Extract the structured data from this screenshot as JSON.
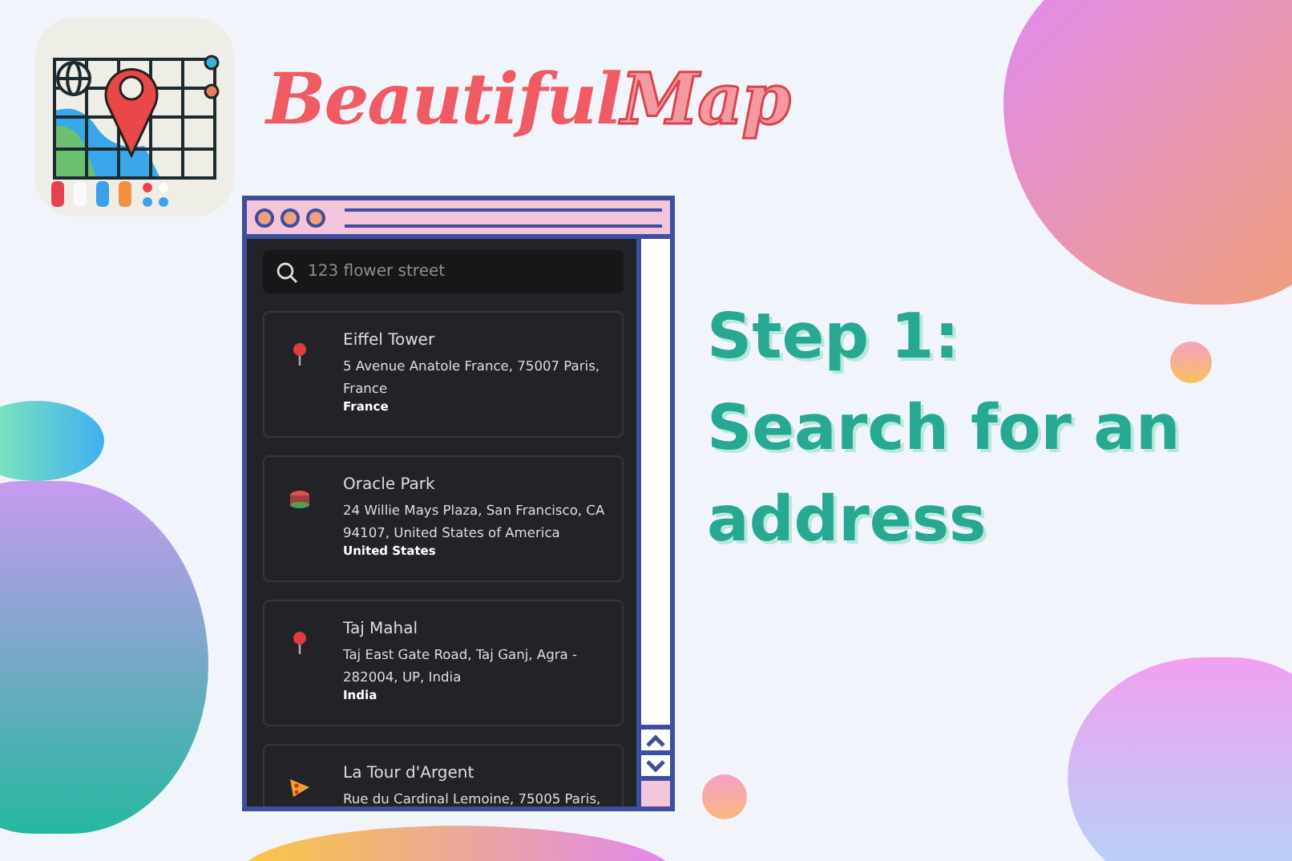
{
  "brand": {
    "title_solid": "Beautiful",
    "title_outline": "Map"
  },
  "search": {
    "placeholder": "123 flower street"
  },
  "results": [
    {
      "kind": "pin",
      "name": "Eiffel Tower",
      "address": "5 Avenue Anatole France, 75007 Paris, France",
      "country": "France"
    },
    {
      "kind": "stadium",
      "name": "Oracle Park",
      "address": "24 Willie Mays Plaza, San Francisco, CA 94107, United States of America",
      "country": "United States"
    },
    {
      "kind": "pin",
      "name": "Taj Mahal",
      "address": "Taj East Gate Road, Taj Ganj, Agra - 282004, UP, India",
      "country": "India"
    },
    {
      "kind": "food",
      "name": "La Tour d'Argent",
      "address": "Rue du Cardinal Lemoine, 75005 Paris,"
    }
  ],
  "heading_lines": [
    "Step 1:",
    "Search for an",
    "address"
  ]
}
